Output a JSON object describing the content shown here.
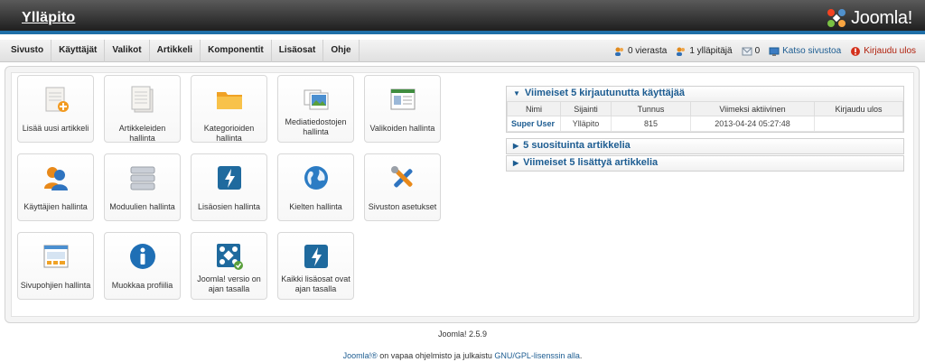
{
  "header": {
    "title": "Ylläpito",
    "logo_text": "Joomla!"
  },
  "menu": [
    "Sivusto",
    "Käyttäjät",
    "Valikot",
    "Artikkeli",
    "Komponentit",
    "Lisäosat",
    "Ohje"
  ],
  "status": {
    "visitors": "0 vierasta",
    "admins": "1 ylläpitäjä",
    "messages": "0",
    "view_site": "Katso sivustoa",
    "logout": "Kirjaudu ulos"
  },
  "icons": {
    "add_article": "Lisää uusi artikkeli",
    "article_manager": "Artikkeleiden hallinta",
    "category_manager": "Kategorioiden hallinta",
    "media_manager": "Mediatiedostojen hallinta",
    "menu_manager": "Valikoiden hallinta",
    "user_manager": "Käyttäjien hallinta",
    "module_manager": "Moduulien hallinta",
    "extension_manager": "Lisäosien hallinta",
    "language_manager": "Kielten hallinta",
    "global_config": "Sivuston asetukset",
    "template_manager": "Sivupohjien hallinta",
    "edit_profile": "Muokkaa profiilia",
    "joomla_update": "Joomla! versio on ajan tasalla",
    "extensions_update": "Kaikki lisäosat ovat ajan tasalla"
  },
  "panels": {
    "logged_in_title": "Viimeiset 5 kirjautunutta käyttäjää",
    "popular_title": "5 suosituinta artikkelia",
    "latest_title": "Viimeiset 5 lisättyä artikkelia",
    "columns": [
      "Nimi",
      "Sijainti",
      "Tunnus",
      "Viimeksi aktiivinen",
      "Kirjaudu ulos"
    ],
    "rows": [
      {
        "name": "Super User",
        "location": "Ylläpito",
        "id": "815",
        "last_active": "2013-04-24 05:27:48",
        "logout": ""
      }
    ]
  },
  "footer": {
    "version": "Joomla! 2.5.9",
    "link1": "Joomla!®",
    "text": " on vapaa ohjelmisto ja julkaistu ",
    "link2": "GNU/GPL-lisenssin alla",
    "end": "."
  }
}
